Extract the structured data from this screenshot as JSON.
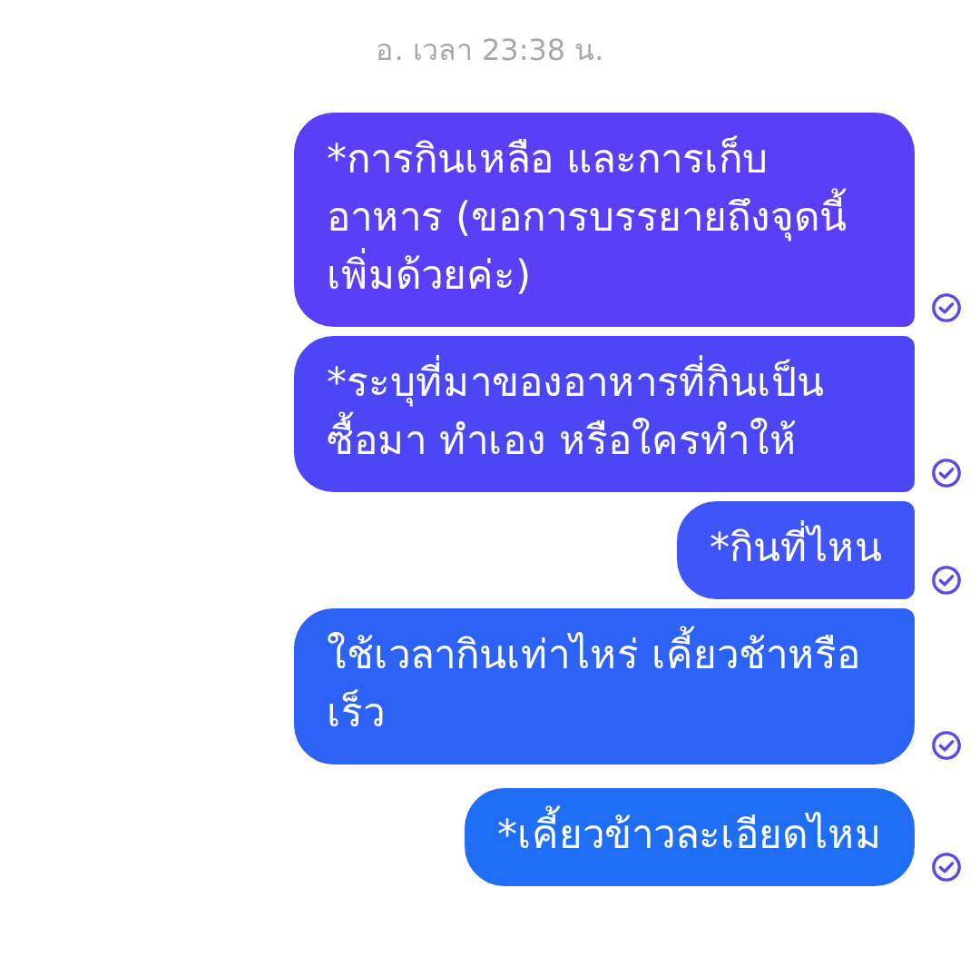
{
  "timestamp": "อ. เวลา 23:38 น.",
  "groups": [
    {
      "messages": [
        {
          "text": "*การกินเหลือ และการเก็บอาหาร (ขอการบรรยายถึงจุดนี้เพิ่มด้วยค่ะ)",
          "delivered": true
        },
        {
          "text": "*ระบุที่มาของอาหารที่กินเป็น ซื้อมา ทำเอง หรือใครทำให้",
          "delivered": true
        },
        {
          "text": "*กินที่ไหน",
          "delivered": true
        },
        {
          "text": "ใช้เวลากินเท่าไหร่ เคี้ยวช้าหรือเร็ว",
          "delivered": true
        }
      ]
    },
    {
      "messages": [
        {
          "text": "*เคี้ยวข้าวละเอียดไหม",
          "delivered": true
        }
      ]
    }
  ]
}
